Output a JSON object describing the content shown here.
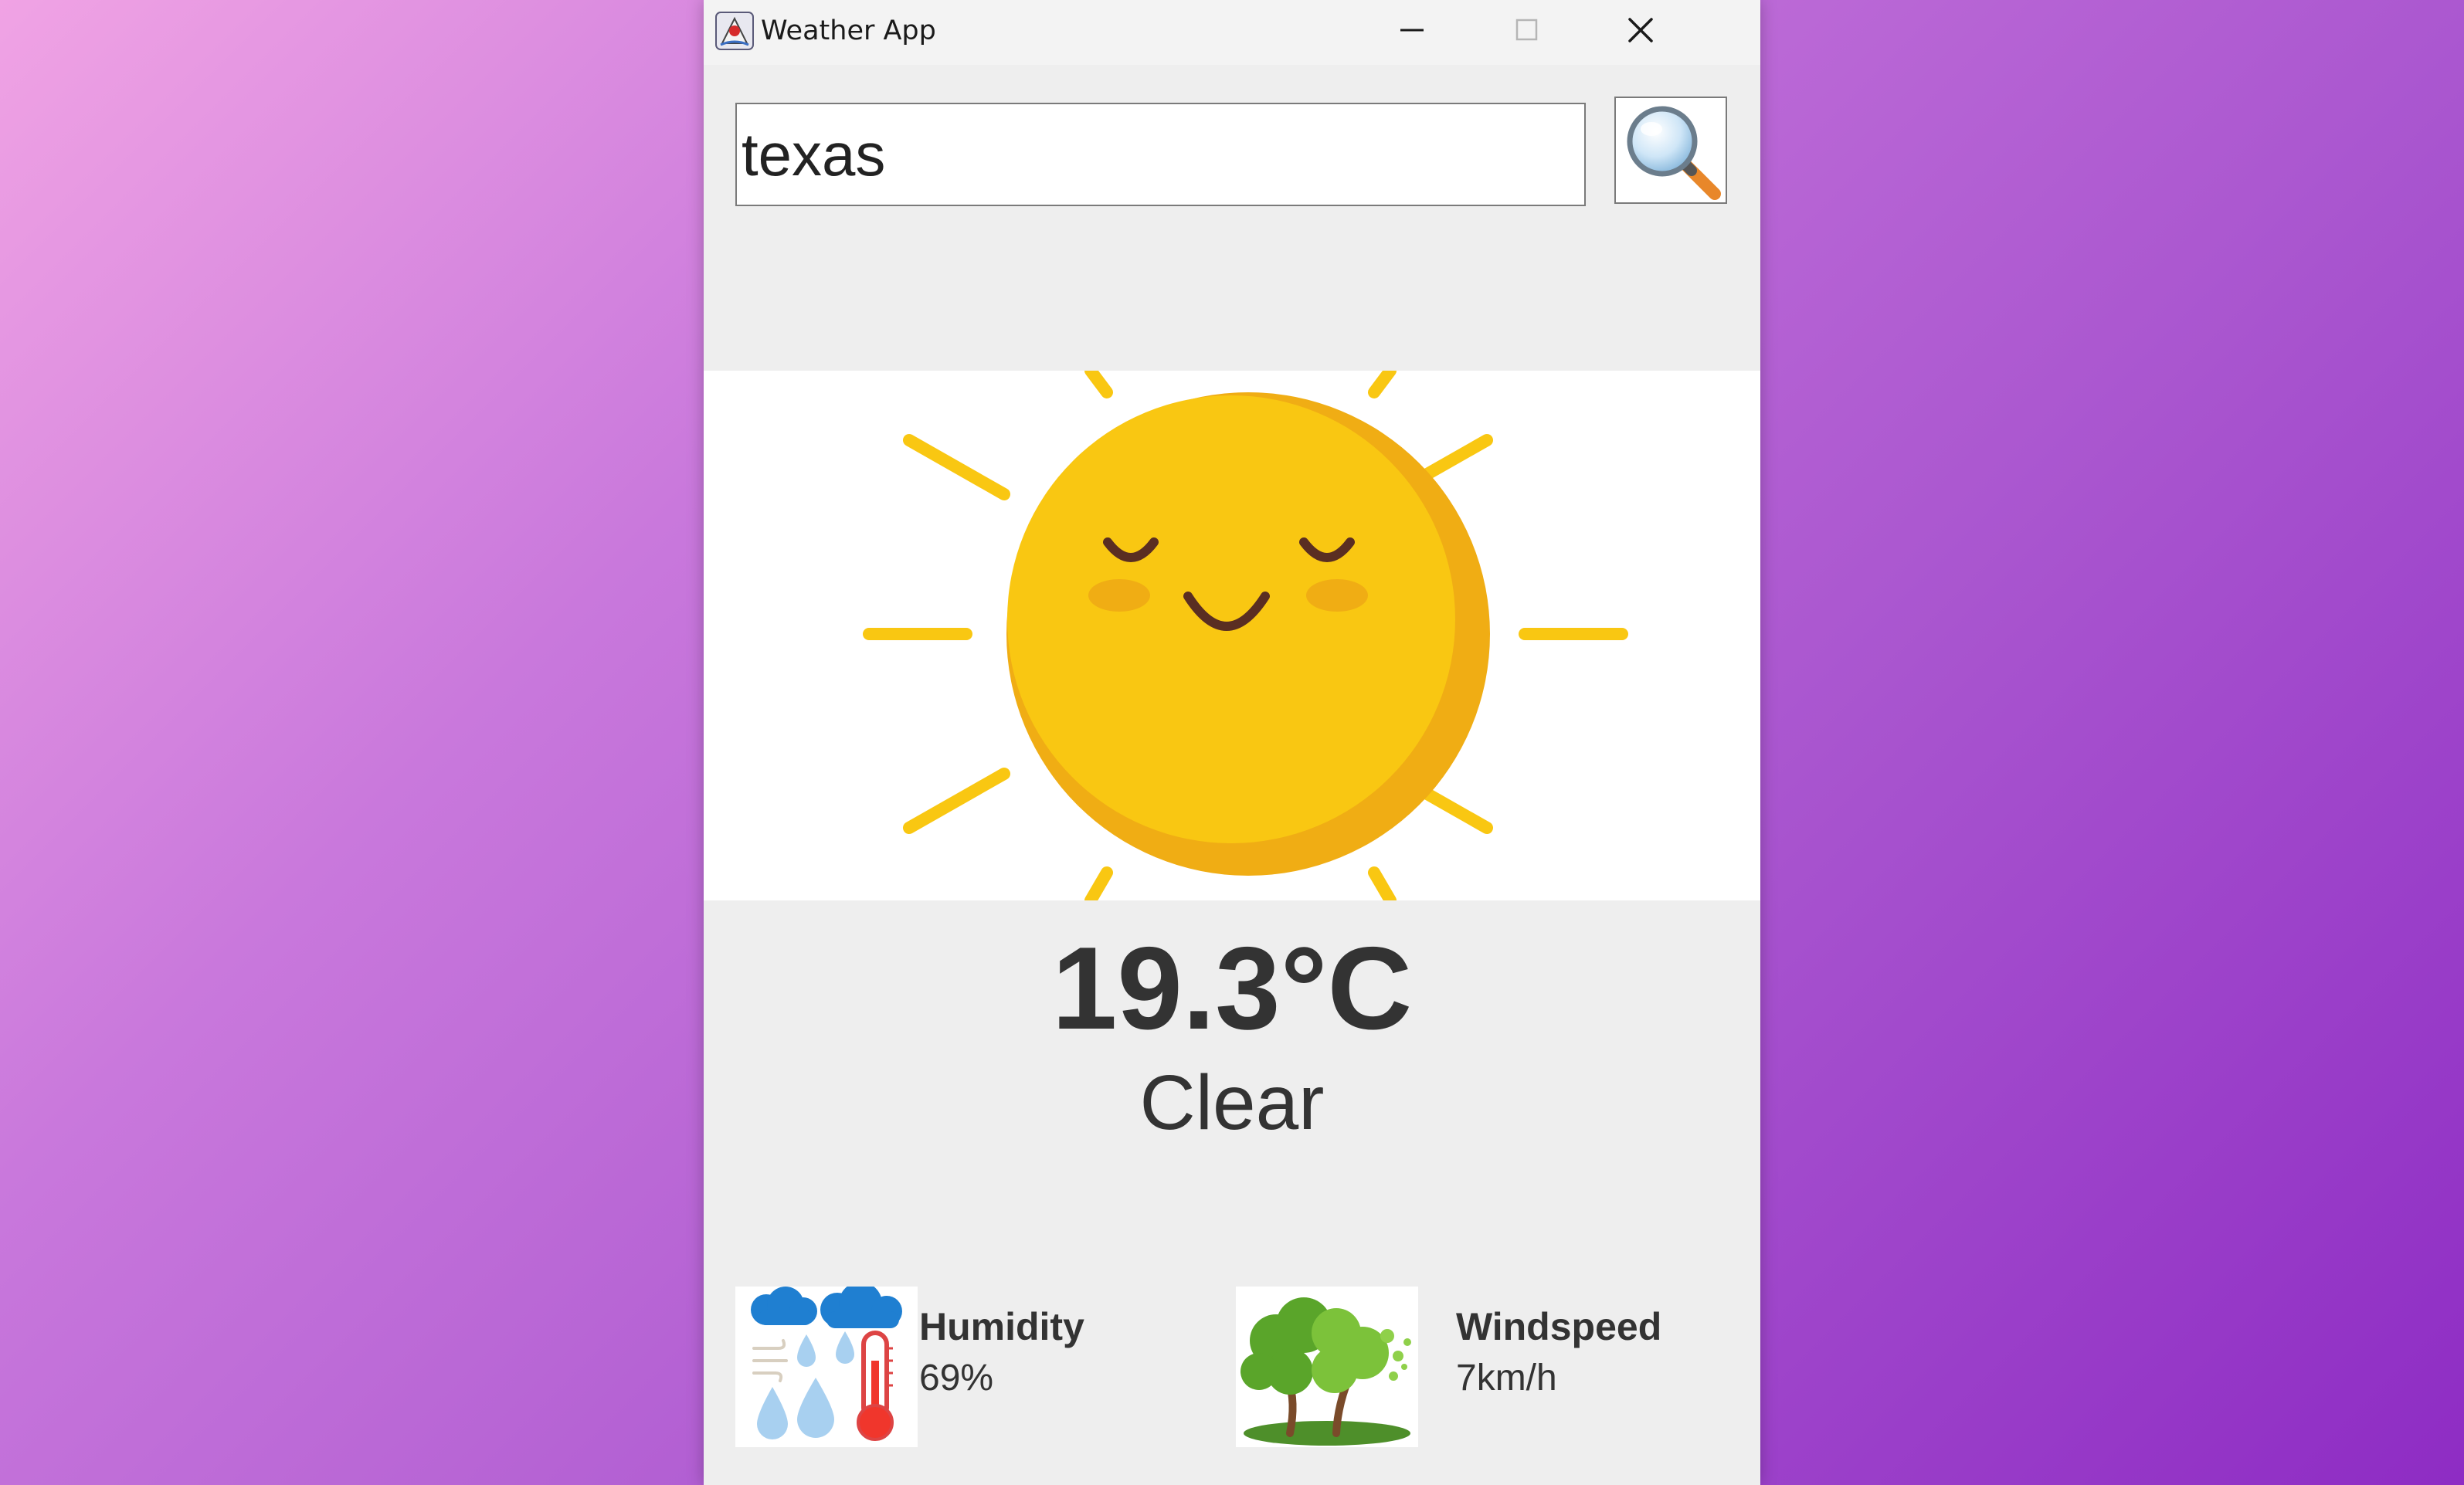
{
  "window": {
    "title": "Weather App"
  },
  "search": {
    "value": "texas"
  },
  "weather": {
    "temperature": "19.3°C",
    "condition": "Clear"
  },
  "humidity": {
    "label": "Humidity",
    "value": "69%"
  },
  "windspeed": {
    "label": "Windspeed",
    "value": "7km/h"
  },
  "colors": {
    "background_start": "#f0a3e4",
    "background_end": "#8e2cc4",
    "panel": "#eeeeee",
    "sun": "#f9c712",
    "sun_shadow": "#f0ad14",
    "text": "#333333"
  },
  "icons": {
    "app": "java-coffee-icon",
    "search": "magnifying-glass-icon",
    "weather": "smiling-sun-icon",
    "humidity": "humidity-rain-thermometer-icon",
    "windspeed": "wind-tree-icon"
  }
}
